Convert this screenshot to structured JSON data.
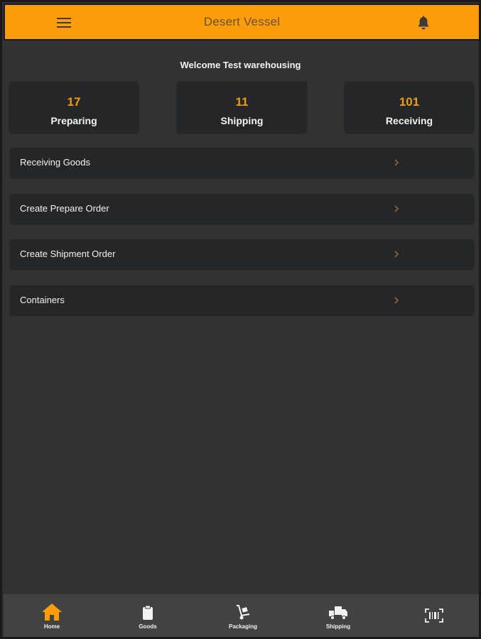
{
  "header": {
    "title": "Desert Vessel",
    "menu_icon": "hamburger-menu-icon",
    "bell_icon": "bell-icon"
  },
  "welcome": "Welcome Test warehousing",
  "stats": [
    {
      "value": "17",
      "label": "Preparing"
    },
    {
      "value": "11",
      "label": "Shipping"
    },
    {
      "value": "101",
      "label": "Receiving"
    }
  ],
  "menu": [
    {
      "label": "Receiving Goods"
    },
    {
      "label": "Create Prepare Order"
    },
    {
      "label": "Create Shipment Order"
    },
    {
      "label": "Containers"
    }
  ],
  "bottom_nav": [
    {
      "label": "Home",
      "icon": "home-icon",
      "active": true
    },
    {
      "label": "Goods",
      "icon": "clipboard-icon"
    },
    {
      "label": "Packaging",
      "icon": "hand-truck-icon"
    },
    {
      "label": "Shipping",
      "icon": "delivery-truck-icon"
    },
    {
      "label": "",
      "icon": "barcode-scan-icon"
    }
  ],
  "colors": {
    "accent": "#fb9c0b",
    "background": "#323232",
    "card": "#252628",
    "nav": "#424242",
    "stat_value": "#f39a12"
  }
}
